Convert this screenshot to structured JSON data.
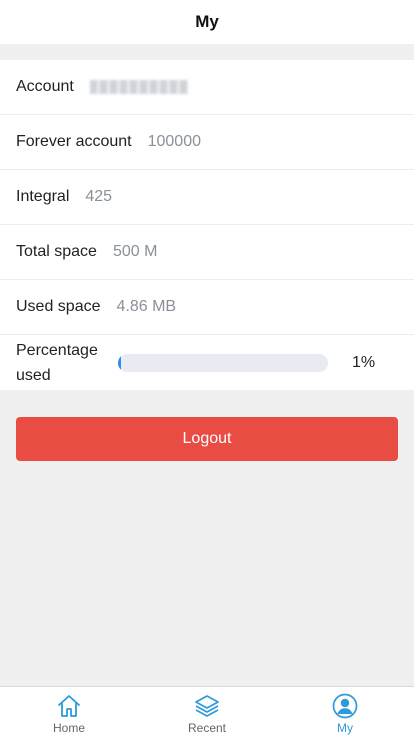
{
  "header": {
    "title": "My"
  },
  "account": {
    "rows": [
      {
        "label": "Account",
        "value": "17772417425"
      },
      {
        "label": "Forever account",
        "value": "100000"
      },
      {
        "label": "Integral",
        "value": "425"
      },
      {
        "label": "Total space",
        "value": "500 M"
      },
      {
        "label": "Used space",
        "value": "4.86 MB"
      }
    ],
    "percentage": {
      "label": "Percentage used",
      "value_text": "1%",
      "fill_fraction": 0.01
    }
  },
  "actions": {
    "logout_label": "Logout"
  },
  "tabbar": {
    "items": [
      {
        "label": "Home",
        "icon": "home-icon",
        "active": false
      },
      {
        "label": "Recent",
        "icon": "layers-icon",
        "active": false
      },
      {
        "label": "My",
        "icon": "user-icon",
        "active": true
      }
    ]
  },
  "colors": {
    "accent": "#2d9bd8",
    "logout": "#e84c43",
    "progress": "#2d8cf0"
  }
}
